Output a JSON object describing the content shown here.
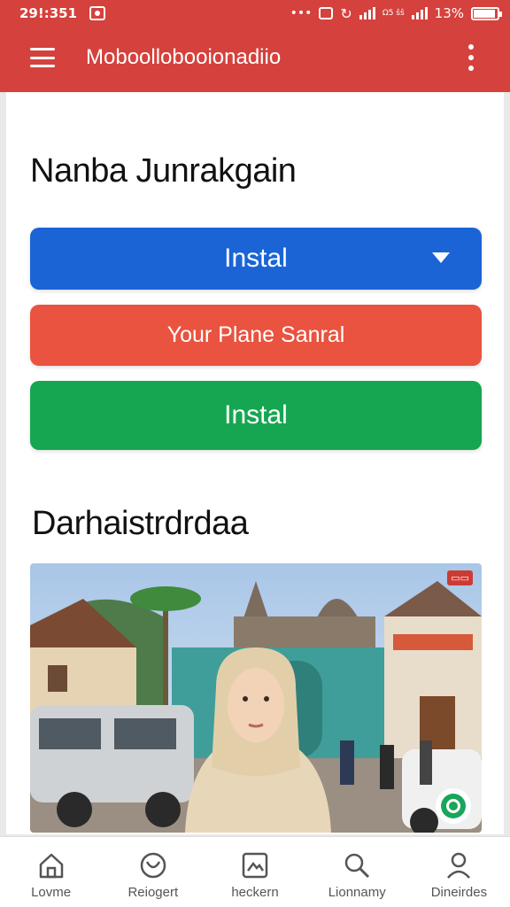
{
  "status_bar": {
    "time": "29!:351",
    "mini_text": "Ω5 ŝŝ",
    "battery_text": "13%"
  },
  "app_bar": {
    "title": "Moboollobooionadiio"
  },
  "content": {
    "heading_1": "Nanba Junrakgain",
    "buttons": [
      {
        "label": "Instal",
        "color": "#1a64d6"
      },
      {
        "label": "Your Plane Sanral",
        "color": "#e9533f"
      },
      {
        "label": "Instal",
        "color": "#16a651"
      }
    ],
    "heading_2": "Darhaistrdrdaa"
  },
  "bottom_nav": {
    "items": [
      {
        "label": "Lovme",
        "icon": "home-icon"
      },
      {
        "label": "Reiogert",
        "icon": "bag-icon"
      },
      {
        "label": "heckern",
        "icon": "image-icon"
      },
      {
        "label": "Lionnamy",
        "icon": "search-icon"
      },
      {
        "label": "Dineirdes",
        "icon": "person-icon"
      }
    ]
  }
}
